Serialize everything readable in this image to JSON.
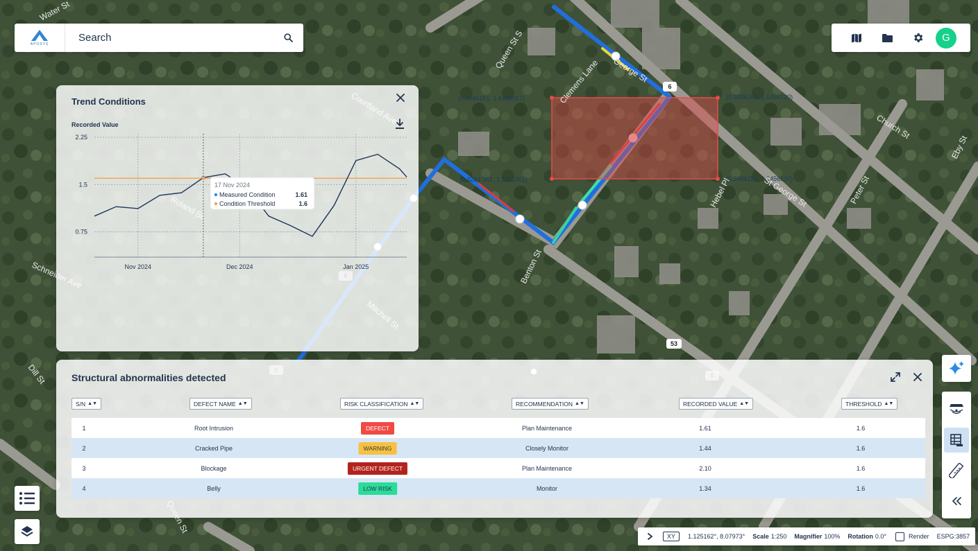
{
  "search": {
    "label": "Search",
    "logo_text": "APOSYS"
  },
  "user": {
    "avatar_initial": "G"
  },
  "map": {
    "street_labels": [
      "Water St",
      "Queen St S",
      "Courtland Ave",
      "Roland St",
      "Schneider Ave",
      "Clemens Lane",
      "George St",
      "Church St",
      "Eby St",
      "Hebel Pl",
      "St George St",
      "Peter St",
      "Benton St",
      "Mitchell St",
      "Dill St",
      "Queen St"
    ],
    "route_markers": [
      "6",
      "6",
      "6",
      "53",
      "6"
    ],
    "coordinate_labels": [
      "(0.3486151, 1.6438017)",
      "(0.3486151, 1.6456120)",
      "(0.3284.361, 1.5411361)",
      "(0.3486151, 1.6456120)"
    ]
  },
  "trend": {
    "title": "Trend Conditions",
    "tooltip": {
      "date": "17 Nov 2024",
      "measured_label": "Measured Condition",
      "measured_value": "1.61",
      "threshold_label": "Condition Threshold",
      "threshold_value": "1.6"
    }
  },
  "chart_data": {
    "type": "line",
    "ylabel": "Recorded Value",
    "yticks": [
      "2.25",
      "1.5",
      "0.75"
    ],
    "ylim": [
      0.35,
      2.25
    ],
    "xticks": [
      "Nov 2024",
      "Dec 2024",
      "Jan 2025"
    ],
    "xtick_positions": [
      12,
      40,
      72
    ],
    "xlim": [
      0,
      86
    ],
    "series": [
      {
        "name": "Measured Condition",
        "color": "#1d3557",
        "x": [
          0,
          6,
          12,
          18,
          24,
          30,
          36,
          42,
          48,
          54,
          60,
          66,
          72,
          78,
          84,
          86
        ],
        "values": [
          1.0,
          1.15,
          1.12,
          1.33,
          1.37,
          1.61,
          1.67,
          1.45,
          1.0,
          0.85,
          0.68,
          1.17,
          1.88,
          1.98,
          1.75,
          1.62
        ]
      },
      {
        "name": "Condition Threshold",
        "color": "#f5a04b",
        "x": [
          0,
          86
        ],
        "values": [
          1.6,
          1.6
        ]
      }
    ],
    "highlight": {
      "x": 30,
      "measured": 1.61,
      "threshold": 1.6
    },
    "grid": true
  },
  "abnormalities": {
    "title": "Structural abnormalities detected",
    "columns": [
      "S/N",
      "DEFECT NAME",
      "RISK CLASSIFICATION",
      "RECOMMENDATION",
      "RECORDED VALUE",
      "THRESHOLD"
    ],
    "rows": [
      {
        "sn": "1",
        "name": "Root Intrusion",
        "risk": "DEFECT",
        "risk_color": "#f04a45",
        "recommendation": "Plan Maintenance",
        "value": "1.61",
        "threshold": "1.6"
      },
      {
        "sn": "2",
        "name": "Cracked Pipe",
        "risk": "WARNING",
        "risk_color": "#f6c142",
        "recommendation": "Closely Monitor",
        "value": "1.44",
        "threshold": "1.6"
      },
      {
        "sn": "3",
        "name": "Blockage",
        "risk": "URGENT DEFECT",
        "risk_color": "#b3231e",
        "recommendation": "Plan Maintenance",
        "value": "2.10",
        "threshold": "1.6"
      },
      {
        "sn": "4",
        "name": "Belly",
        "risk": "LOW RISK",
        "risk_color": "#2bdc97",
        "recommendation": "Monitor",
        "value": "1.34",
        "threshold": "1.6"
      }
    ]
  },
  "status": {
    "xy_label": "XY",
    "coordinates": "1.125162°, 8.07973°",
    "scale_label": "Scale",
    "scale_value": "1:250",
    "magnifier_label": "Magnifier",
    "magnifier_value": "100%",
    "rotation_label": "Rotation",
    "rotation_value": "0.0°",
    "render_label": "Render",
    "epsg": "ESPG:3857"
  }
}
